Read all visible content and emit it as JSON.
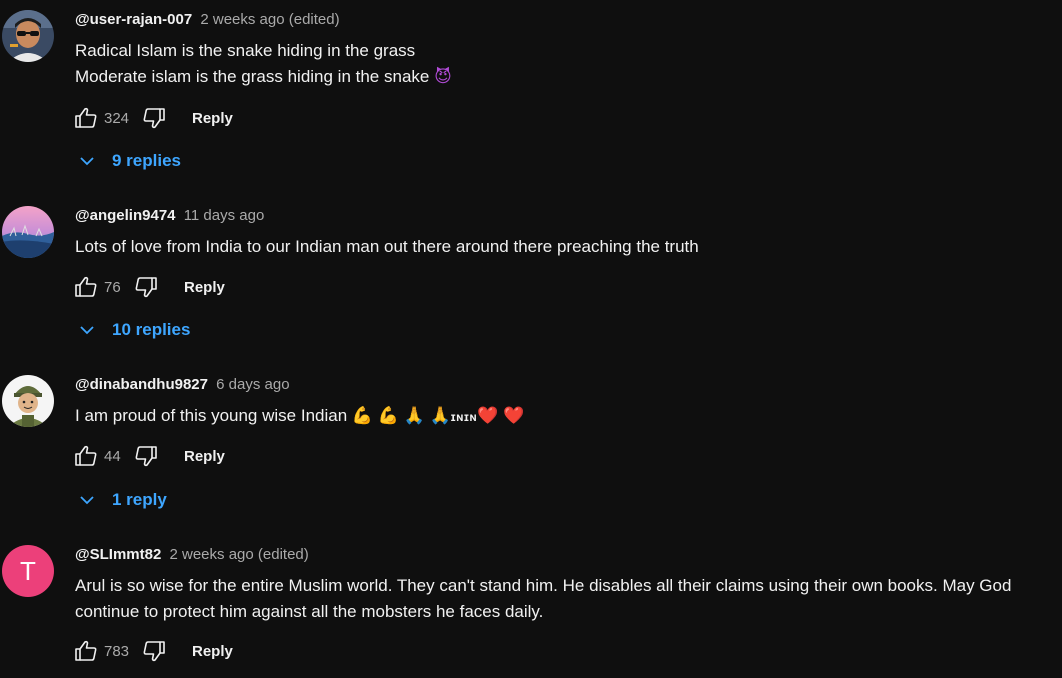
{
  "comments": [
    {
      "handle": "@user-rajan-007",
      "time": "2 weeks ago (edited)",
      "lines": [
        "Radical Islam is the snake hiding in the grass",
        "Moderate islam is the grass hiding in the snake"
      ],
      "emoji": "😈",
      "likes": "324",
      "reply_label": "Reply",
      "replies_label": "9 replies",
      "avatar_icon": "man-with-sunglasses-avatar"
    },
    {
      "handle": "@angelin9474",
      "time": "11 days ago",
      "lines": [
        "Lots of love from India to our Indian man out there around there preaching the truth"
      ],
      "likes": "76",
      "reply_label": "Reply",
      "replies_label": "10 replies",
      "avatar_icon": "pink-landscape-avatar"
    },
    {
      "handle": "@dinabandhu9827",
      "time": "6 days ago",
      "lines": [
        "I am proud of this young wise Indian"
      ],
      "emojis": [
        "💪",
        "💪",
        "🙏",
        "🙏",
        "ɪɴɪɴ",
        "❤️",
        "❤️"
      ],
      "likes": "44",
      "reply_label": "Reply",
      "replies_label": "1 reply",
      "avatar_icon": "soldier-cartoon-avatar"
    },
    {
      "handle": "@SLImmt82",
      "time": "2 weeks ago (edited)",
      "lines": [
        "Arul is so wise for the entire Muslim world. They can't stand him. He disables all their claims using their own books. May God continue to protect him against all the mobsters he faces daily."
      ],
      "likes": "783",
      "reply_label": "Reply",
      "avatar_letter": "T",
      "avatar_color": "#ec407a"
    }
  ],
  "colors": {
    "background": "#0f0f0f",
    "text": "#f1f1f1",
    "muted": "#aaaaaa",
    "link": "#3ea6ff"
  }
}
